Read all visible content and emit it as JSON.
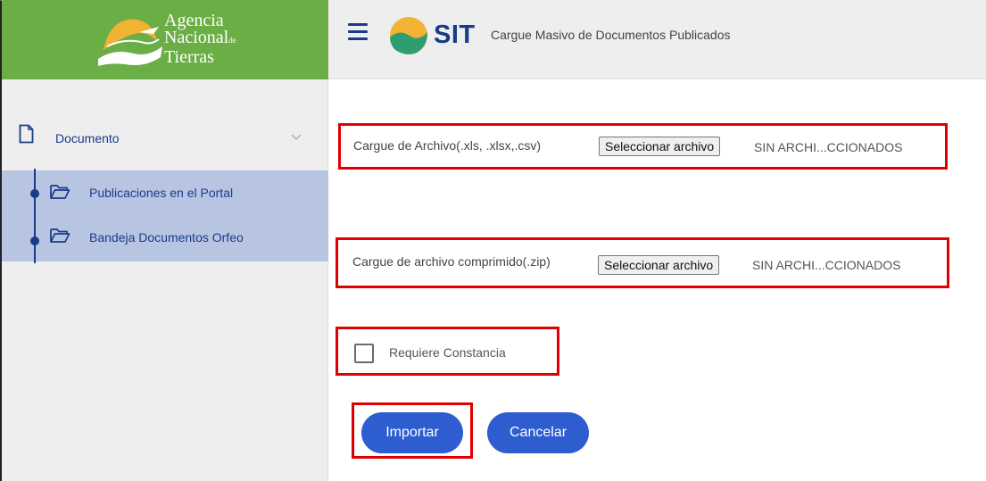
{
  "logo": {
    "line1": "Agencia",
    "line2": "Nacional",
    "line2_small": "de",
    "line3": "Tierras"
  },
  "header": {
    "brand": "SIT",
    "title": "Cargue Masivo de Documentos Publicados"
  },
  "sidebar": {
    "section": {
      "label": "Documento",
      "icon": "document-icon"
    },
    "items": [
      {
        "label": "Publicaciones en el Portal",
        "icon": "folder-open-icon"
      },
      {
        "label": "Bandeja Documentos Orfeo",
        "icon": "folder-open-icon"
      }
    ]
  },
  "form": {
    "excel": {
      "label": "Cargue de Archivo(.xls, .xlsx,.csv)",
      "button": "Seleccionar archivo",
      "status": "SIN ARCHI...CCIONADOS"
    },
    "zip": {
      "label": "Cargue de archivo comprimido(.zip)",
      "button": "Seleccionar archivo",
      "status": "SIN ARCHI...CCIONADOS"
    },
    "constancia": {
      "label": "Requiere Constancia",
      "checked": false
    },
    "import_label": "Importar",
    "cancel_label": "Cancelar"
  },
  "colors": {
    "logo_green": "#6aae45",
    "nav_blue": "#1a3a8a",
    "submenu_bg": "#b8c5e2",
    "button_blue": "#2e5dd0",
    "highlight_red": "#e00000"
  }
}
